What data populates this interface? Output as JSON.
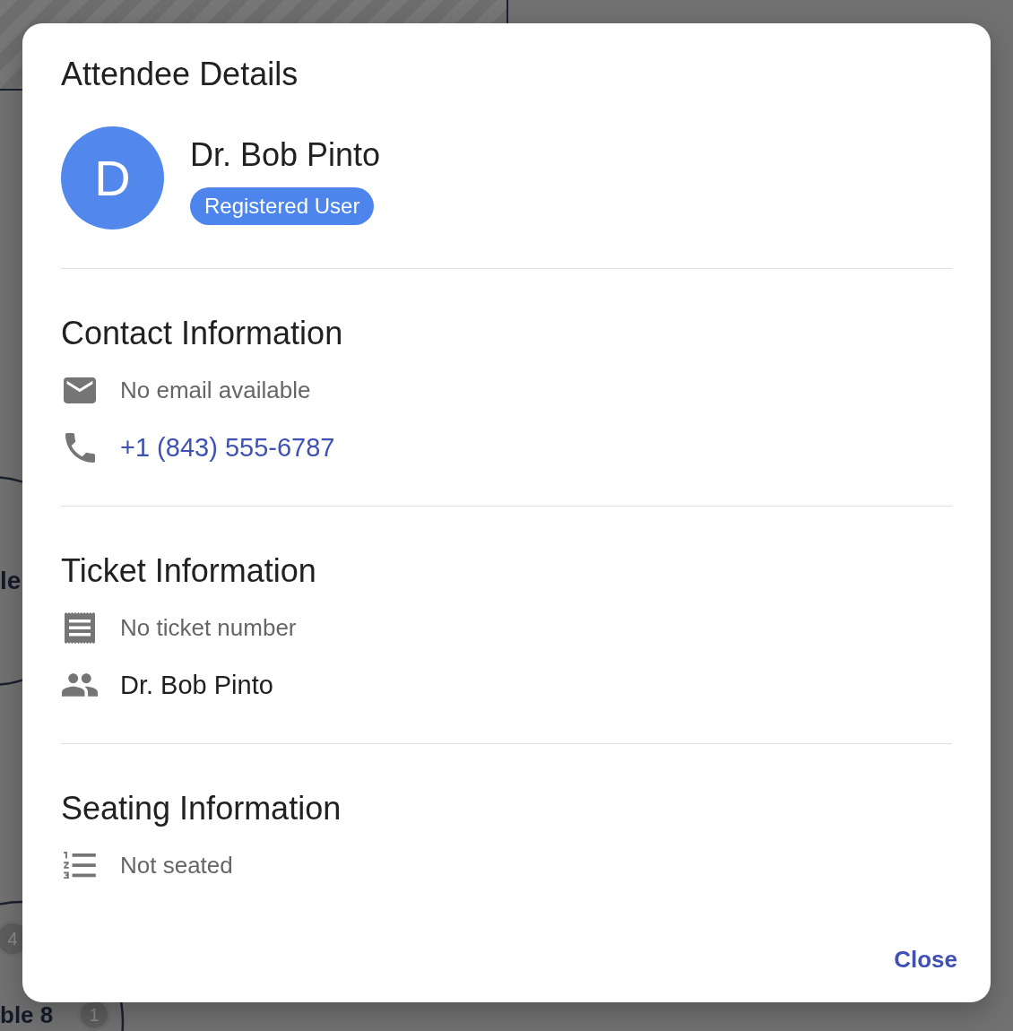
{
  "backdrop": {
    "table_labels": [
      "le",
      "ble 8"
    ],
    "seat_badges": [
      "4",
      "1"
    ]
  },
  "dialog": {
    "title": "Attendee Details",
    "attendee": {
      "initial": "D",
      "name": "Dr. Bob Pinto",
      "badge": "Registered User"
    },
    "sections": [
      {
        "heading": "Contact Information",
        "rows": [
          {
            "kind": "email",
            "text": "No email available",
            "muted": true,
            "link": false
          },
          {
            "kind": "phone",
            "text": "+1 (843) 555-6787",
            "muted": false,
            "link": true
          }
        ]
      },
      {
        "heading": "Ticket Information",
        "rows": [
          {
            "kind": "ticket",
            "text": "No ticket number",
            "muted": true,
            "link": false
          },
          {
            "kind": "guest",
            "text": "Dr. Bob Pinto",
            "muted": false,
            "link": false
          }
        ]
      },
      {
        "heading": "Seating Information",
        "rows": [
          {
            "kind": "seat",
            "text": "Not seated",
            "muted": true,
            "link": false
          }
        ]
      }
    ],
    "actions": [
      {
        "label": "Close"
      }
    ]
  }
}
